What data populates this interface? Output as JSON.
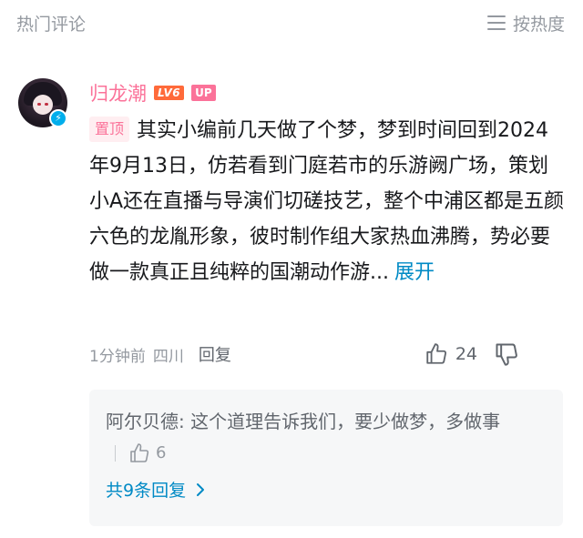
{
  "header": {
    "title": "热门评论",
    "sort_label": "按热度",
    "sort_icon": "menu-lines-icon"
  },
  "comment": {
    "username": "归龙潮",
    "level_badge": "LV6",
    "up_badge": "UP",
    "avatar_badge_icon": "lightning-icon",
    "pin_tag": "置顶",
    "text": "其实小编前几天做了个梦，梦到时间回到2024年9月13日，仿若看到门庭若市的乐游阙广场，策划小A还在直播与导演们切磋技艺，整个中浦区都是五颜六色的龙胤形象，彼时制作组大家热血沸腾，势必要做一款真正且纯粹的国潮动作游...",
    "expand_label": "展开",
    "time": "1分钟前",
    "location": "四川",
    "reply_label": "回复",
    "like_count": "24",
    "colors": {
      "username": "#fb7299",
      "link": "#008ac5",
      "level_badge": "#ff6a3a"
    }
  },
  "reply": {
    "author": "阿尔贝德",
    "text": "这个道理告诉我们，要少做梦，多做事",
    "like_count": "6",
    "more_label": "共9条回复"
  }
}
